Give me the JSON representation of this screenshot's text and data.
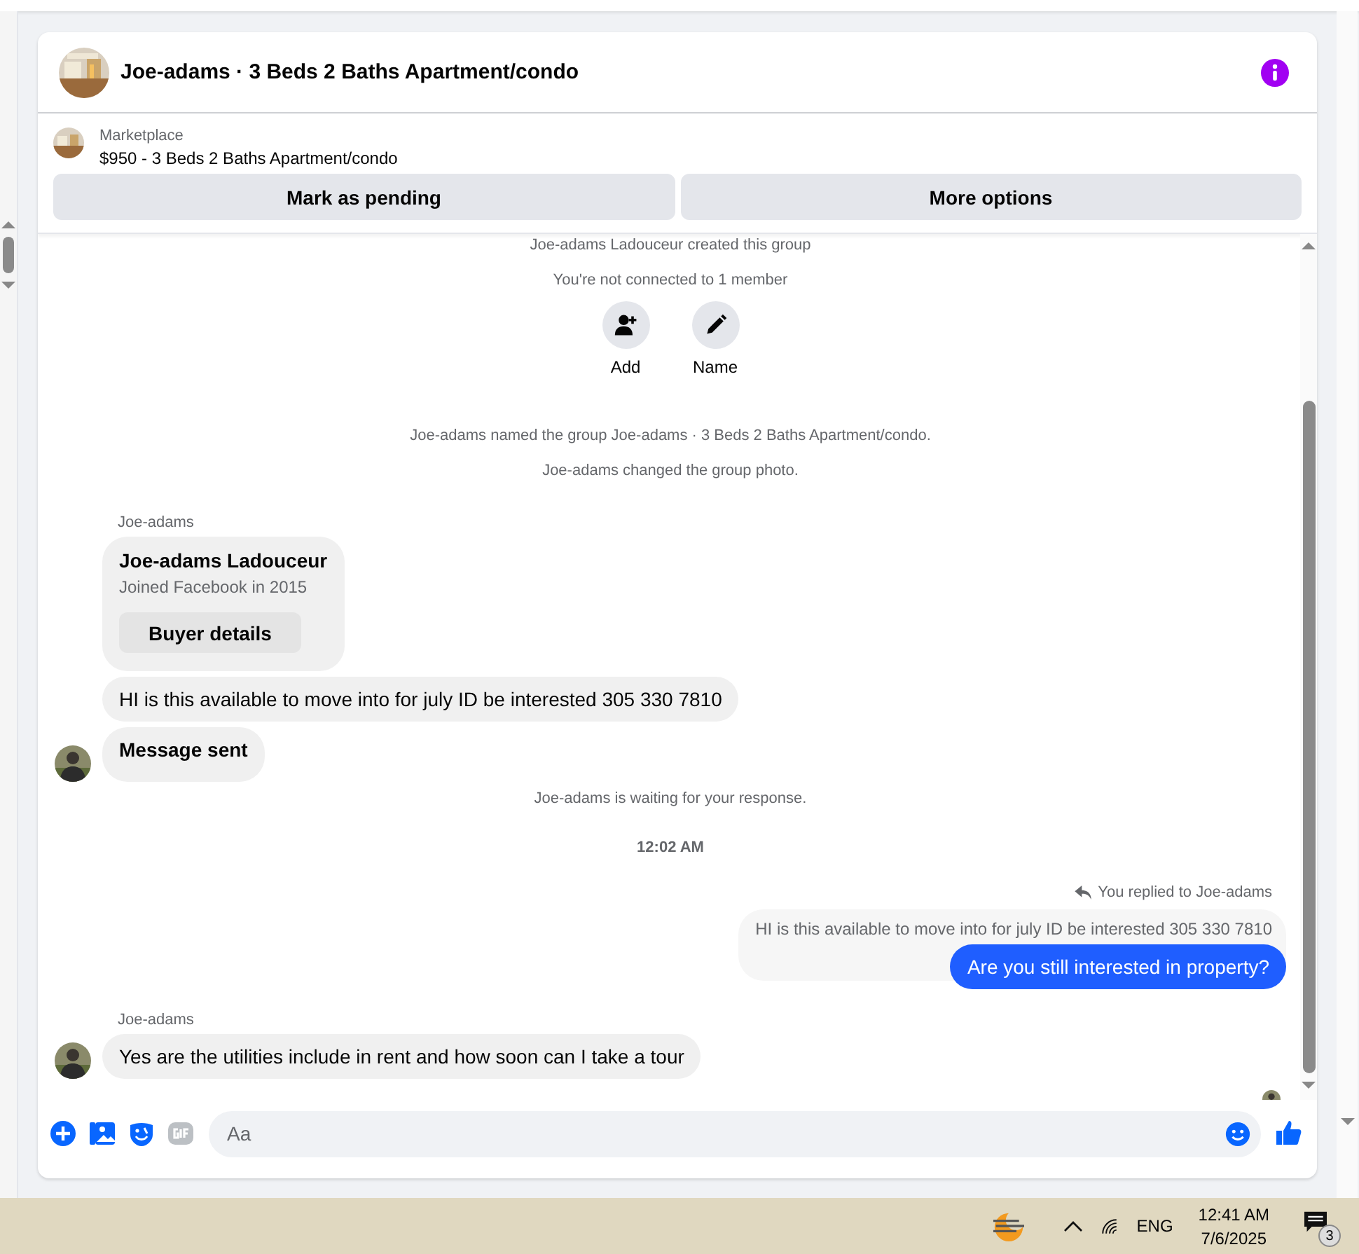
{
  "chat": {
    "title": "Joe-adams · 3 Beds 2 Baths Apartment/condo"
  },
  "listing": {
    "source": "Marketplace",
    "title": "$950 - 3 Beds 2 Baths Apartment/condo",
    "buttons": [
      "Mark as pending",
      "More options"
    ]
  },
  "messages": [
    {
      "kind": "system",
      "text": "Joe-adams Ladouceur created this group"
    },
    {
      "kind": "system",
      "text": "You're not connected to 1 member"
    },
    {
      "kind": "actions",
      "items": [
        {
          "kind": "add",
          "label": "Add"
        },
        {
          "kind": "edit",
          "label": "Name"
        }
      ]
    },
    {
      "kind": "system",
      "text": "Joe-adams named the group Joe-adams · 3 Beds 2 Baths Apartment/condo."
    },
    {
      "kind": "system",
      "text": "Joe-adams changed the group photo."
    },
    {
      "kind": "sender",
      "text": "Joe-adams"
    },
    {
      "kind": "profile",
      "name": "Joe-adams Ladouceur",
      "subtitle": "Joined Facebook in 2015",
      "button": "Buyer details"
    },
    {
      "kind": "incoming",
      "text": "HI is this available to move into for july ID be interested 305 330 7810",
      "bold": false,
      "avatar": false
    },
    {
      "kind": "incoming",
      "text": "Message sent",
      "bold": true,
      "avatar": true
    },
    {
      "kind": "system",
      "text": "Joe-adams is waiting for your response."
    },
    {
      "kind": "time",
      "text": "12:02 AM"
    },
    {
      "kind": "reply_note",
      "text": "You replied to Joe-adams"
    },
    {
      "kind": "quoted",
      "text": "HI is this available to move into for july ID be interested 305 330 7810"
    },
    {
      "kind": "outgoing",
      "text": "Are you still interested in property?"
    },
    {
      "kind": "sender",
      "text": "Joe-adams"
    },
    {
      "kind": "incoming",
      "text": "Yes are the utilities include in rent and how soon can I take a tour",
      "bold": false,
      "avatar": true
    }
  ],
  "composer": {
    "placeholder": "Aa"
  },
  "taskbar": {
    "language": "ENG",
    "time": "12:41 AM",
    "date": "7/6/2025",
    "notifications": "3"
  }
}
